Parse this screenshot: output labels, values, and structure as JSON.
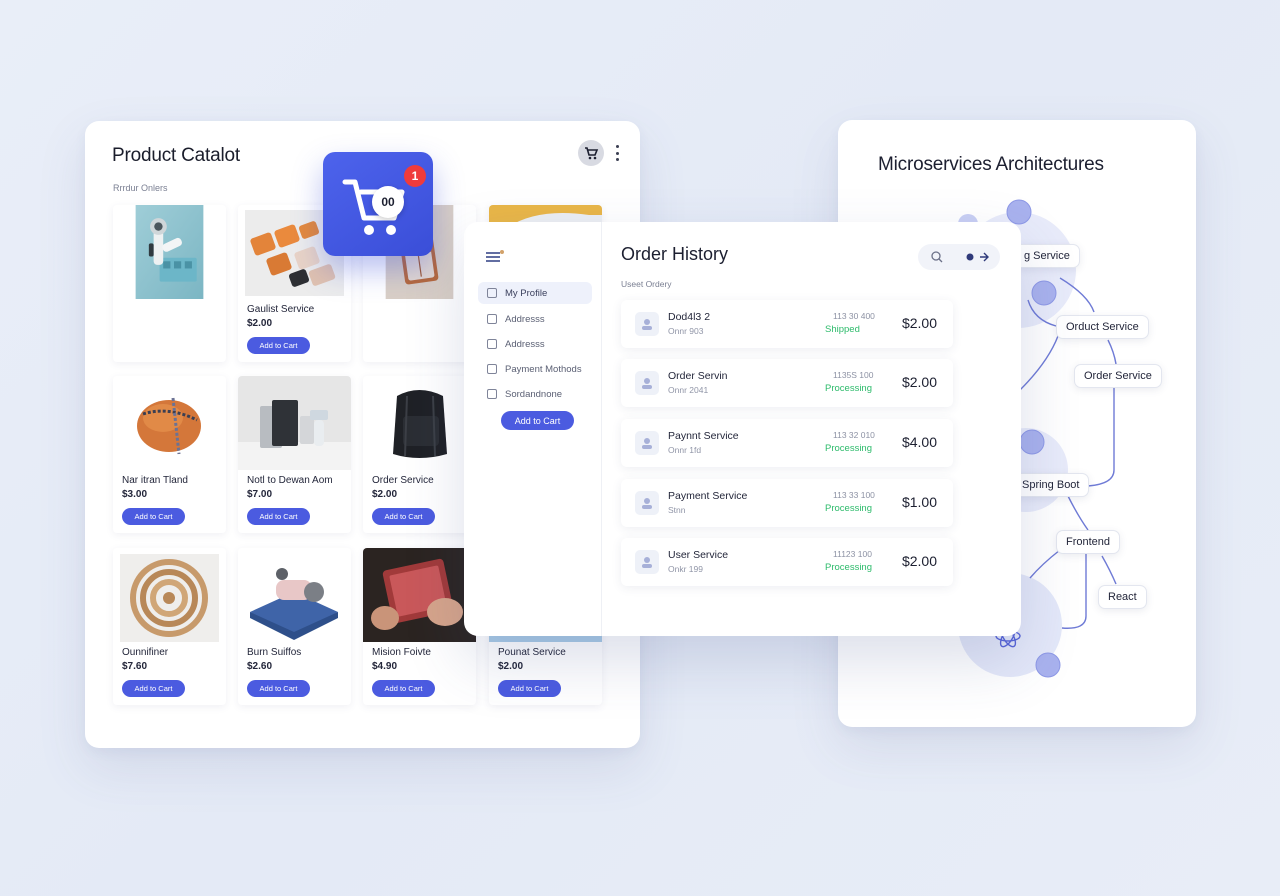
{
  "catalog": {
    "title": "Product Catalot",
    "subtitle": "Rrrdur Onlers",
    "products": [
      {
        "name": "",
        "price": "",
        "button": ""
      },
      {
        "name": "Gaulist Service",
        "price": "$2.00",
        "button": "Add to Cart"
      },
      {
        "name": "",
        "price": "",
        "button": ""
      },
      {
        "name": "",
        "price": "",
        "button": ""
      },
      {
        "name": "Nar itran Tland",
        "price": "$3.00",
        "button": "Add to Cart"
      },
      {
        "name": "Notl to Dewan Aom",
        "price": "$7.00",
        "button": "Add to Cart"
      },
      {
        "name": "Order Service",
        "price": "$2.00",
        "button": "Add to Cart"
      },
      {
        "name": "Ounnifiner",
        "price": "$7.60",
        "button": "Add to Cart"
      },
      {
        "name": "Burn Suiffos",
        "price": "$2.60",
        "button": "Add to Cart"
      },
      {
        "name": "Mision Foivte",
        "price": "$4.90",
        "button": "Add to Cart"
      },
      {
        "name": "Pounat Service",
        "price": "$2.00",
        "button": "Add to Cart"
      }
    ]
  },
  "cart": {
    "badge": "1",
    "count": "00"
  },
  "orders": {
    "title": "Order History",
    "subtitle": "Useet Ordery",
    "menu": [
      {
        "label": "My Profile",
        "active": true
      },
      {
        "label": "Addresss"
      },
      {
        "label": "Addresss"
      },
      {
        "label": "Payment Mothods"
      },
      {
        "label": "Sordandnone"
      }
    ],
    "side_button": "Add to Cart",
    "rows": [
      {
        "name": "Dod4l3 2",
        "sub": "Onnr 903",
        "date": "113 30 400",
        "status": "Shipped",
        "price": "$2.00"
      },
      {
        "name": "Order Servin",
        "sub": "Onnr 2041",
        "date": "1135S 100",
        "status": "Processing",
        "price": "$2.00"
      },
      {
        "name": "Paynnt Service",
        "sub": "Onnr 1fd",
        "date": "113 32 010",
        "status": "Processing",
        "price": "$4.00"
      },
      {
        "name": "Payment Service",
        "sub": "Stnn",
        "date": "113 33 100",
        "status": "Processing",
        "price": "$1.00"
      },
      {
        "name": "User Service",
        "sub": "Onkr 199",
        "date": "11123 100",
        "status": "Processing",
        "price": "$2.00"
      }
    ]
  },
  "architecture": {
    "title": "Microservices Architectures",
    "nodes": [
      "g Service",
      "Orduct Service",
      "Order Service",
      "Spring Boot",
      "Frontend",
      "React"
    ]
  },
  "colors": {
    "accent": "#4b5be0",
    "success": "#2dbb6b",
    "badge": "#ef3b3b",
    "node": "#a9b2ee"
  }
}
